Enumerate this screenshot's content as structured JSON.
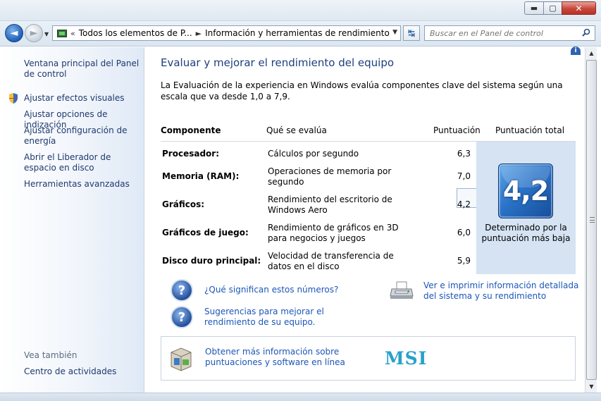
{
  "window": {
    "minimize_label": "▬",
    "maximize_label": "▢",
    "close_label": "✕"
  },
  "nav": {
    "back_label": "◄",
    "forward_label": "►",
    "breadcrumb_prefix": "«",
    "breadcrumbs": [
      "Todos los elementos de P...",
      "Información y herramientas de rendimiento"
    ],
    "breadcrumb_sep": "►",
    "refresh_label": "↹",
    "search_placeholder": "Buscar en el Panel de control"
  },
  "sidebar": {
    "items": [
      {
        "label": "Ventana principal del Panel de control"
      },
      {
        "label": "Ajustar efectos visuales"
      },
      {
        "label": "Ajustar opciones de indización"
      },
      {
        "label": "Ajustar configuración de energía"
      },
      {
        "label": "Abrir el Liberador de espacio en disco"
      },
      {
        "label": "Herramientas avanzadas"
      }
    ],
    "see_also_title": "Vea también",
    "see_also_items": [
      {
        "label": "Centro de actividades"
      }
    ]
  },
  "main": {
    "title": "Evaluar y mejorar el rendimiento del equipo",
    "intro": "La Evaluación de la experiencia en Windows evalúa componentes clave del sistema según una escala que va desde 1,0 a 7,9.",
    "table": {
      "headers": [
        "Componente",
        "Qué se evalúa",
        "Puntuación",
        "Puntuación total"
      ],
      "rows": [
        {
          "component": "Procesador:",
          "measures": "Cálculos por segundo",
          "score": "6,3"
        },
        {
          "component": "Memoria (RAM):",
          "measures": "Operaciones de memoria por segundo",
          "score": "7,0"
        },
        {
          "component": "Gráficos:",
          "measures": "Rendimiento del escritorio de Windows Aero",
          "score": "4,2"
        },
        {
          "component": "Gráficos de juego:",
          "measures": "Rendimiento de gráficos en 3D para negocios y juegos",
          "score": "6,0"
        },
        {
          "component": "Disco duro principal:",
          "measures": "Velocidad de transferencia de datos en el disco",
          "score": "5,9"
        }
      ],
      "base_score": "4,2",
      "base_caption": "Determinado por la puntuación más baja"
    },
    "links": {
      "what_numbers": "¿Qué significan estos números?",
      "tips": "Sugerencias para mejorar el rendimiento de su equipo.",
      "print_details": "Ver e imprimir información detallada del sistema y su rendimiento"
    },
    "info_box": {
      "link": "Obtener más información sobre puntuaciones y software en línea",
      "logo_text": "MSI"
    }
  },
  "colors": {
    "link": "#1c56b8",
    "title": "#1e3f7a",
    "badge": "#2a73c8",
    "total_panel": "#d5e3f3",
    "msi": "#2aa1c8"
  },
  "icons": [
    "back-arrow-icon",
    "forward-arrow-icon",
    "control-panel-icon",
    "refresh-icon",
    "search-icon",
    "shield-icon",
    "help-icon",
    "printer-icon",
    "software-box-icon",
    "info-icon"
  ]
}
